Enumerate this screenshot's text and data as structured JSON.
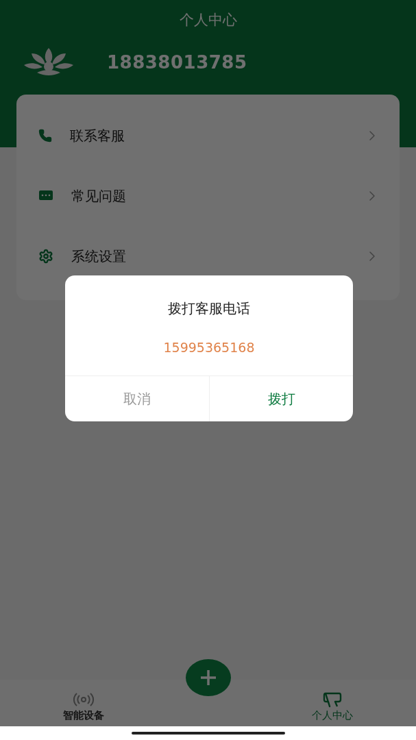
{
  "header": {
    "title": "个人中心",
    "phone": "18838013785"
  },
  "menu": [
    {
      "kind": "phone",
      "label": "联系客服"
    },
    {
      "kind": "faq",
      "label": "常见问题"
    },
    {
      "kind": "settings",
      "label": "系统设置"
    }
  ],
  "dialog": {
    "title": "拨打客服电话",
    "number": "15995365168",
    "buttons": [
      {
        "kind": "cancel",
        "label": "取消"
      },
      {
        "kind": "confirm",
        "label": "拨打"
      }
    ]
  },
  "tab_bar": {
    "tabs": [
      {
        "kind": "devices",
        "label": "智能设备",
        "selected": false
      },
      {
        "kind": "profile",
        "label": "个人中心",
        "selected": true
      }
    ]
  }
}
